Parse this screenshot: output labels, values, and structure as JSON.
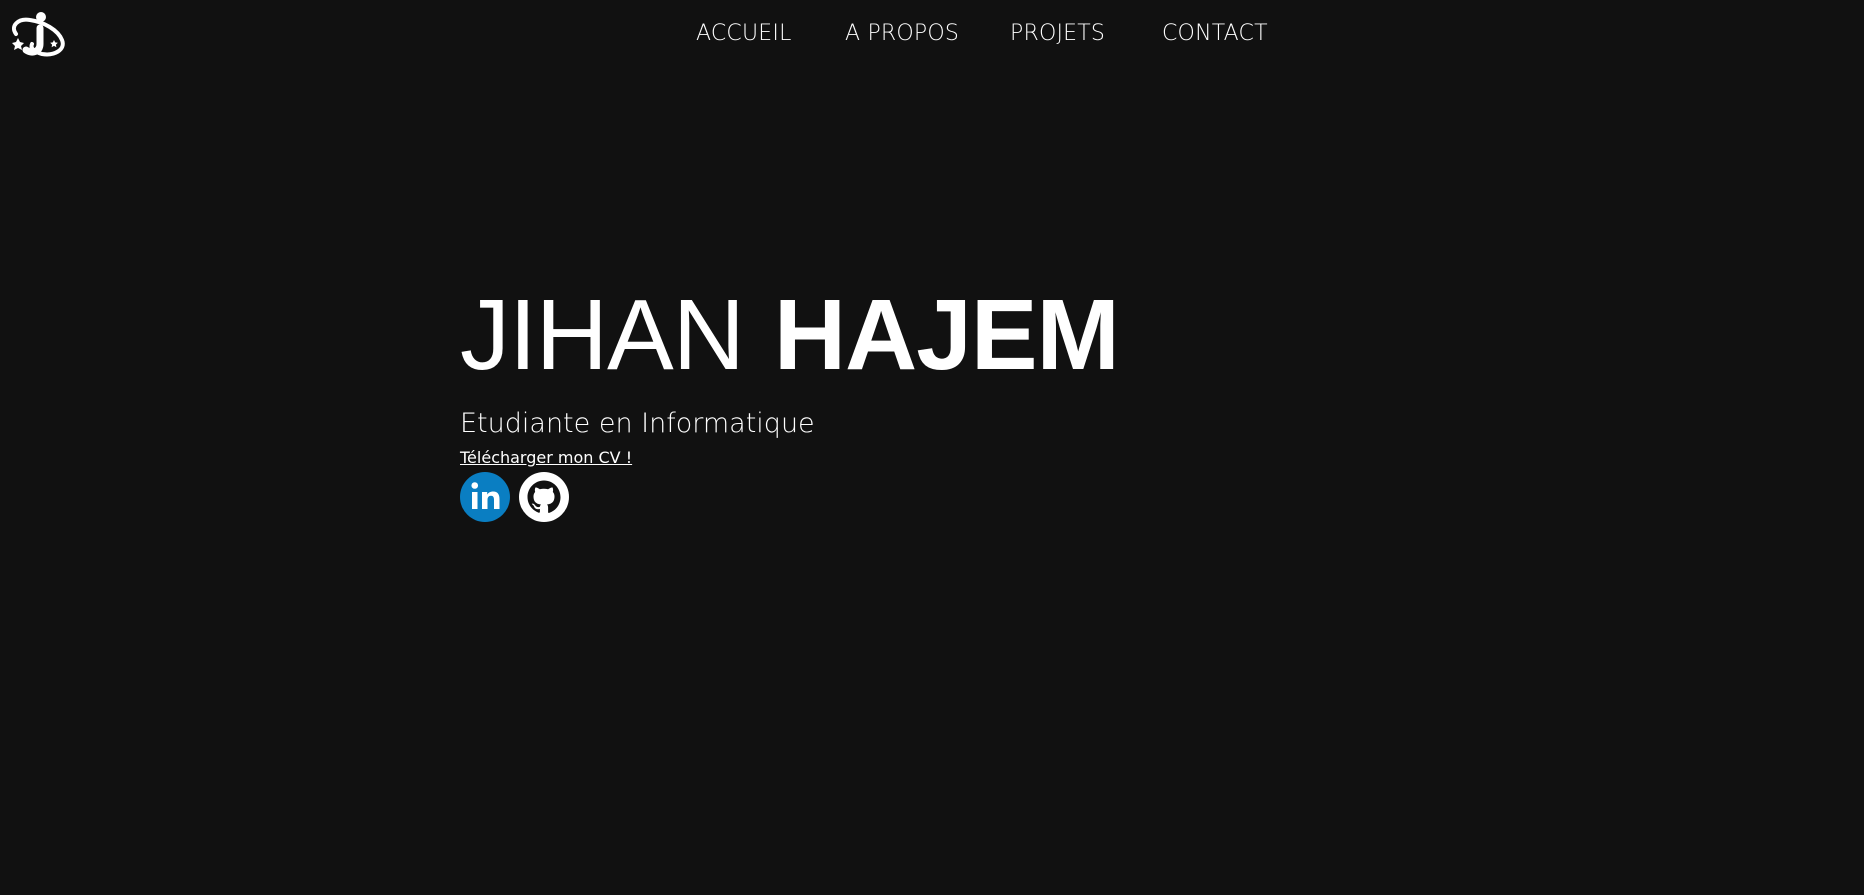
{
  "logo": {
    "icon": "ji-monogram-logo"
  },
  "nav": {
    "items": [
      {
        "label": "ACCUEIL"
      },
      {
        "label": "A PROPOS"
      },
      {
        "label": "PROJETS"
      },
      {
        "label": "CONTACT"
      }
    ]
  },
  "hero": {
    "first_name": "JIHAN",
    "last_name": "HAJEM",
    "subtitle": "Etudiante en Informatique",
    "cv_link": "Télécharger mon CV !"
  },
  "socials": [
    {
      "icon": "linkedin-icon",
      "color": "#0A7EC2"
    },
    {
      "icon": "github-icon",
      "color": "#ffffff"
    }
  ],
  "colors": {
    "background": "#111111",
    "text": "#ffffff",
    "linkedin": "#0A7EC2"
  }
}
